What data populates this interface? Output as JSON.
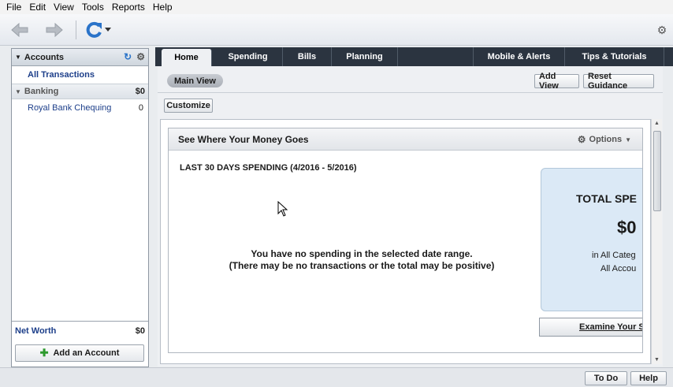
{
  "menu": [
    "File",
    "Edit",
    "View",
    "Tools",
    "Reports",
    "Help"
  ],
  "toolbar": {
    "back": "back-arrow-icon",
    "forward": "forward-arrow-icon",
    "refresh": "refresh-icon",
    "settings": "gear-icon"
  },
  "sidebar": {
    "header": "Accounts",
    "all_transactions": "All Transactions",
    "group": {
      "label": "Banking",
      "value": "$0"
    },
    "accounts": [
      {
        "label": "Royal Bank Chequing",
        "value": "0"
      }
    ],
    "net_worth": {
      "label": "Net Worth",
      "value": "$0"
    },
    "add_account": "Add an Account"
  },
  "tabs": [
    {
      "label": "Home",
      "active": true
    },
    {
      "label": "Spending"
    },
    {
      "label": "Bills"
    },
    {
      "label": "Planning"
    },
    {
      "label": "Mobile & Alerts"
    },
    {
      "label": "Tips & Tutorials"
    }
  ],
  "main": {
    "view": "Main View",
    "add_view": "Add View",
    "reset_guidance": "Reset Guidance",
    "customize": "Customize",
    "panel": {
      "title": "See Where Your Money Goes",
      "options": "Options",
      "spending_title": "LAST 30 DAYS SPENDING (4/2016 - 5/2016)",
      "no_spending_line1": "You have no spending in the selected date range.",
      "no_spending_line2": "(There may be no transactions or the total may be positive)",
      "total_title": "TOTAL SPE",
      "total_amount": "$0",
      "total_line1": "in All Categ",
      "total_line2": "All Accou",
      "examine": "Examine Your S"
    }
  },
  "bottom": {
    "todo": "To Do",
    "help": "Help"
  },
  "colors": {
    "accent_blue": "#1d3f8a",
    "tabbar": "#2b3440",
    "add_plus": "#2e9a2e"
  }
}
